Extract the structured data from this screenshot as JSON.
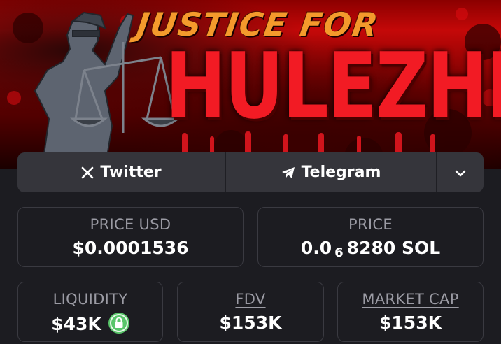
{
  "banner": {
    "title_top": "JUSTICE FOR",
    "title_main": "HULEZHI",
    "image_name": "lady-justice-statue"
  },
  "social": {
    "twitter_label": "Twitter",
    "telegram_label": "Telegram",
    "twitter_icon": "x-logo-icon",
    "telegram_icon": "paper-plane-icon",
    "more_icon": "chevron-down-icon"
  },
  "stats": {
    "price_usd": {
      "label": "PRICE USD",
      "value": "$0.0001536"
    },
    "price_native": {
      "label": "PRICE",
      "value_prefix": "0.0",
      "value_zero_count": "6",
      "value_suffix": "8280 SOL"
    },
    "liquidity": {
      "label": "LIQUIDITY",
      "value": "$43K",
      "badge_icon": "lock-icon"
    },
    "fdv": {
      "label": "FDV",
      "value": "$153K"
    },
    "market_cap": {
      "label": "MARKET CAP",
      "value": "$153K"
    }
  },
  "colors": {
    "background": "#1c1c21",
    "card_border": "#3a3a41",
    "label_gray": "#9b9ba4",
    "bar_bg": "#35353b",
    "lock_green": "#59c56a",
    "banner_red": "#f21b24",
    "banner_orange": "#f49a2c"
  }
}
